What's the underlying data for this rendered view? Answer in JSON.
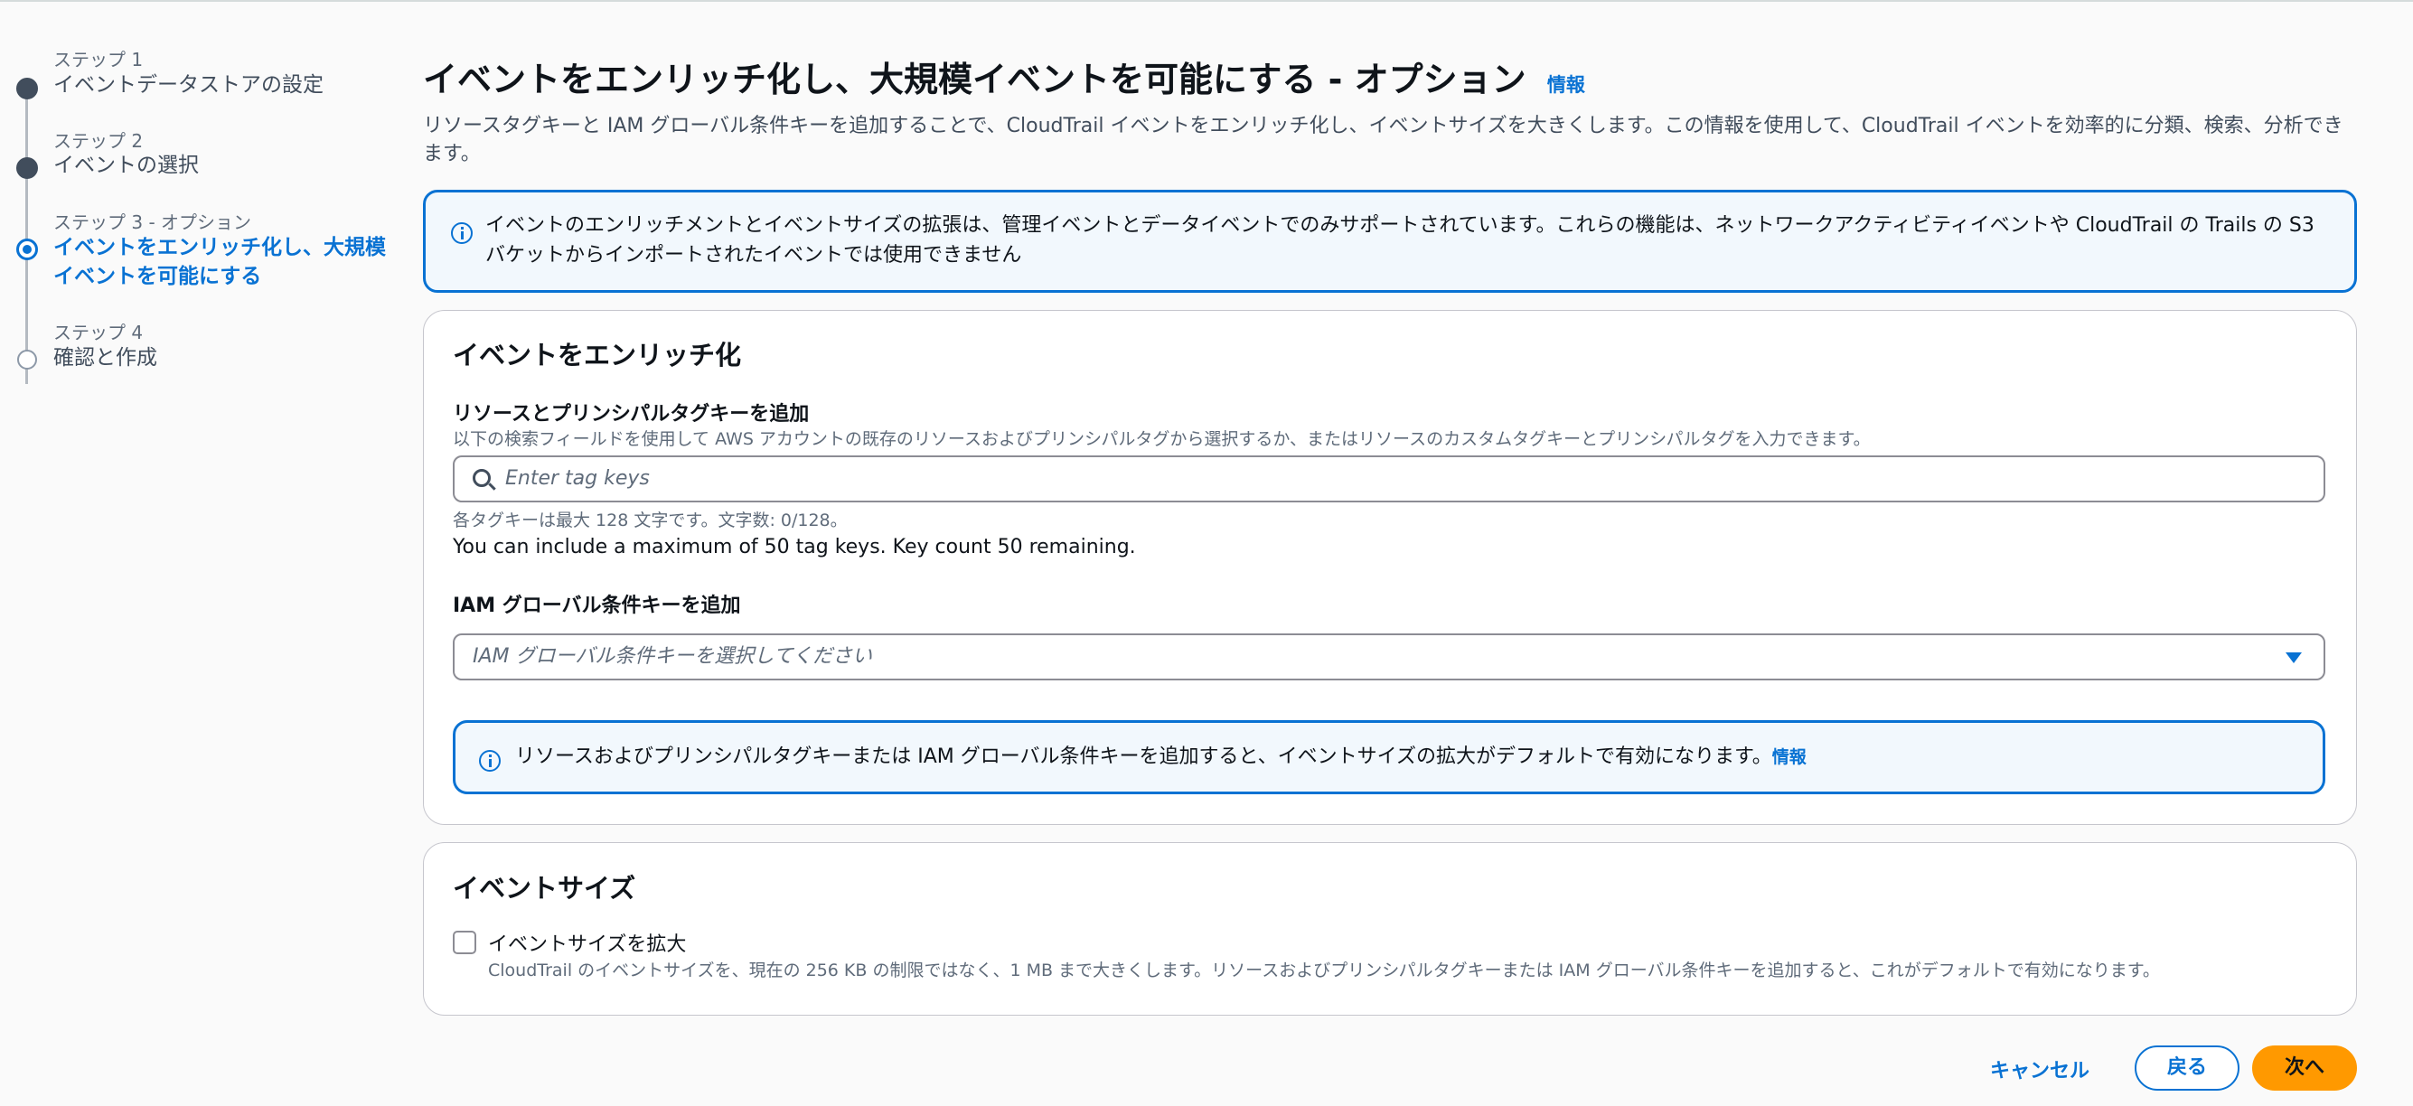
{
  "stepper": {
    "steps": [
      {
        "number": "ステップ 1",
        "title": "イベントデータストアの設定"
      },
      {
        "number": "ステップ 2",
        "title": "イベントの選択"
      },
      {
        "number": "ステップ 3 - オプション",
        "title_line1": "イベントをエンリッチ化し、大規模",
        "title_line2": "イベントを可能にする"
      },
      {
        "number": "ステップ 4",
        "title": "確認と作成"
      }
    ]
  },
  "header": {
    "title": "イベントをエンリッチ化し、大規模イベントを可能にする - オプション",
    "info_link": "情報",
    "description": "リソースタグキーと IAM グローバル条件キーを追加することで、CloudTrail イベントをエンリッチ化し、イベントサイズを大きくします。この情報を使用して、CloudTrail イベントを効率的に分類、検索、分析できます。"
  },
  "alert": {
    "line1": "イベントのエンリッチメントとイベントサイズの拡張は、管理イベントとデータイベントでのみサポートされています。これらの機能は、ネットワークアクティビティイベントや CloudTrail の Trails の S3",
    "line2": "バケットからインポートされたイベントでは使用できません"
  },
  "enrich_card": {
    "title": "イベントをエンリッチ化",
    "tag_label": "リソースとプリンシパルタグキーを追加",
    "tag_desc": "以下の検索フィールドを使用して AWS アカウントの既存のリソースおよびプリンシパルタグから選択するか、またはリソースのカスタムタグキーとプリンシパルタグを入力できます。",
    "tag_placeholder": "Enter tag keys",
    "tag_hint": "各タグキーは最大 128 文字です。文字数: 0/128。",
    "tag_count": "You can include a maximum of 50 tag keys. Key count 50 remaining.",
    "iam_label": "IAM グローバル条件キーを追加",
    "iam_placeholder": "IAM グローバル条件キーを選択してください",
    "inner_alert": "リソースおよびプリンシパルタグキーまたは IAM グローバル条件キーを追加すると、イベントサイズの拡大がデフォルトで有効になります。",
    "inner_alert_link": "情報"
  },
  "size_card": {
    "title": "イベントサイズ",
    "checkbox_label": "イベントサイズを拡大",
    "checkbox_checked": false,
    "checkbox_desc": "CloudTrail のイベントサイズを、現在の 256 KB の制限ではなく、1 MB まで大きくします。リソースおよびプリンシパルタグキーまたは IAM グローバル条件キーを追加すると、これがデフォルトで有効になります。"
  },
  "footer": {
    "cancel": "キャンセル",
    "back": "戻る",
    "next": "次へ"
  },
  "colors": {
    "accent": "#0972d3",
    "primary_button": "#ff9900",
    "info_background": "#f2f8fd"
  }
}
